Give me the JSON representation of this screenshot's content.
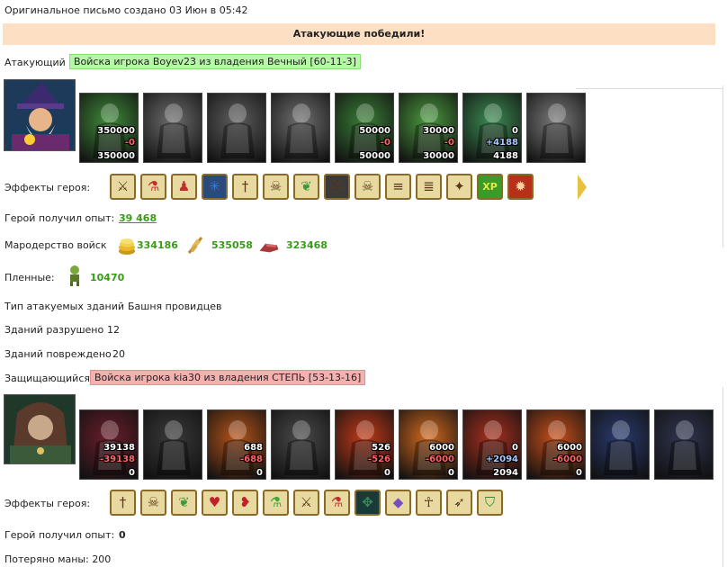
{
  "header": {
    "original_letter": "Оригинальное письмо создано 03 Июн в 05:42"
  },
  "banner": {
    "text": "Атакующие победили!"
  },
  "attacker": {
    "label": "Атакующий",
    "army": "Войска игрока Boyev23 из владения Вечный [60-11-3]",
    "units": [
      {
        "name": "unit-green-archer",
        "n1": "350000",
        "n2": "-0",
        "n3": "350000",
        "n2_type": "loss",
        "tone": "#3f8a3a"
      },
      {
        "name": "unit-grey-knight",
        "n1": "",
        "n2": "",
        "n3": "",
        "tone": "#6d6d6d"
      },
      {
        "name": "unit-grey-spearman",
        "n1": "",
        "n2": "",
        "n3": "",
        "tone": "#5e5e5e"
      },
      {
        "name": "unit-grey-griffin",
        "n1": "",
        "n2": "",
        "n3": "",
        "tone": "#707070"
      },
      {
        "name": "unit-green-bowman",
        "n1": "50000",
        "n2": "-0",
        "n3": "50000",
        "n2_type": "loss",
        "tone": "#3a7d36"
      },
      {
        "name": "unit-green-druid",
        "n1": "30000",
        "n2": "-0",
        "n3": "30000",
        "n2_type": "loss",
        "tone": "#4b9a3e"
      },
      {
        "name": "unit-green-hooded",
        "n1": "0",
        "n2": "+4188",
        "n3": "4188",
        "n2_type": "gain",
        "tone": "#3c8c52"
      },
      {
        "name": "unit-grey-mage",
        "n1": "",
        "n2": "",
        "n3": "",
        "tone": "#7a7a7a"
      }
    ],
    "effects_label": "Эффекты героя:",
    "effects": [
      "sword-boost-icon",
      "potion-icon",
      "pawn-icon",
      "ice-star-icon",
      "sword-split-icon",
      "skull-split-icon",
      "leaf-icon",
      "helmet-icon",
      "skull-icon",
      "scroll-red-icon",
      "scroll-grey-icon",
      "sword-gold-icon",
      "xp-icon",
      "xp-red-icon"
    ],
    "xp_label": "Герой получил опыт:",
    "xp_value": "39 468",
    "loot_label": "Мародерство войск",
    "loot": [
      {
        "icon": "gold-icon",
        "value": "334186"
      },
      {
        "icon": "wheat-icon",
        "value": "535058"
      },
      {
        "icon": "meat-icon",
        "value": "323468"
      }
    ],
    "captives_label": "Пленные:",
    "captives_value": "10470",
    "building_type_label": "Тип атакуемых зданий",
    "building_type_value": "Башня провидцев",
    "destroyed_label": "Зданий разрушено",
    "destroyed_value": "12",
    "damaged_label": "Зданий повреждено",
    "damaged_value": "20"
  },
  "defender": {
    "label": "Защищающийся",
    "army": "Войска игрока kia30 из владения СТЕПЬ [53-13-16]",
    "units": [
      {
        "name": "unit-red-dragon",
        "n1": "39138",
        "n2": "-39138",
        "n3": "0",
        "n2_type": "loss",
        "tone": "#6a1e2a"
      },
      {
        "name": "unit-skeleton",
        "n1": "",
        "n2": "",
        "n3": "",
        "tone": "#3a3a3a"
      },
      {
        "name": "unit-fire-beast",
        "n1": "688",
        "n2": "-688",
        "n3": "0",
        "n2_type": "loss",
        "tone": "#b4541a"
      },
      {
        "name": "unit-dark-gargoyle",
        "n1": "",
        "n2": "",
        "n3": "",
        "tone": "#4a4a4a"
      },
      {
        "name": "unit-lava-golem",
        "n1": "526",
        "n2": "-526",
        "n3": "0",
        "n2_type": "loss",
        "tone": "#c23a18"
      },
      {
        "name": "unit-flame-warrior",
        "n1": "6000",
        "n2": "-6000",
        "n3": "0",
        "n2_type": "loss",
        "tone": "#d2691e"
      },
      {
        "name": "unit-demon-lord",
        "n1": "0",
        "n2": "+2094",
        "n3": "2094",
        "n2_type": "gain",
        "tone": "#a8301e"
      },
      {
        "name": "unit-fire-mage",
        "n1": "6000",
        "n2": "-6000",
        "n3": "0",
        "n2_type": "loss",
        "tone": "#c8501a"
      },
      {
        "name": "unit-tower-blue",
        "n1": "",
        "n2": "",
        "n3": "",
        "tone": "#2a3a6e"
      },
      {
        "name": "unit-tower-purple",
        "n1": "",
        "n2": "",
        "n3": "",
        "tone": "#2f3550"
      }
    ],
    "effects_label": "Эффекты героя:",
    "effects": [
      "sword-split-icon",
      "skull-split-icon",
      "leaf-icon",
      "heart-icon",
      "heart-sword-icon",
      "potion-green-icon",
      "sword-boost-icon",
      "potion-icon",
      "compass-icon",
      "gem-icon",
      "ankh-icon",
      "spear-icon",
      "shield-icon"
    ],
    "xp_label": "Герой получил опыт:",
    "xp_value": "0",
    "mana_lost": "Потеряно маны: 200"
  }
}
